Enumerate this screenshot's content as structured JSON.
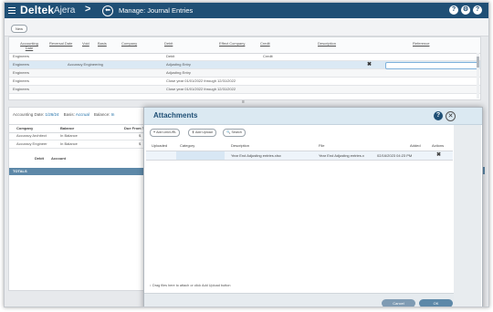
{
  "header": {
    "brand": "Deltek",
    "product": "Ajera",
    "product_chevron": ">",
    "back_glyph": "⬅",
    "title": "Manage: Journal Entries",
    "icons": [
      "help-icon",
      "settings-icon",
      "account-icon"
    ]
  },
  "toolbar": {
    "new_label": "New"
  },
  "journal_grid": {
    "columns": [
      "Accounting Date",
      "Reversal Date",
      "Void",
      "Basis",
      "Company",
      "Debit",
      "Credit",
      "Effect Company",
      "Description",
      "Reference"
    ],
    "rows": [
      {
        "company_col": "Engineers",
        "company": "",
        "debit": "Debit",
        "credit": "Credit",
        "description": ""
      },
      {
        "company_col": "Engineers",
        "company": "Accuracy Engineering",
        "debit": "Adjusting Entry",
        "credit": "",
        "description": ""
      },
      {
        "company_col": "Engineers",
        "company": "",
        "debit": "Adjusting Entry",
        "credit": "",
        "description": ""
      },
      {
        "company_col": "Engineers",
        "company": "",
        "debit": "Close year 01/01/2022 through 12/31/2022",
        "credit": "",
        "description": ""
      },
      {
        "company_col": "Engineers",
        "company": "",
        "debit": "Close year 01/01/2022 through 12/31/2022",
        "credit": "",
        "description": ""
      }
    ],
    "delete_glyph": "✖"
  },
  "details": {
    "accounting_date_label": "Accounting Date:",
    "accounting_date": "1/26/24",
    "basis_label": "Basis:",
    "basis": "Accrual",
    "balance_label": "Balance:",
    "balance_value": "In",
    "columns": [
      "Company",
      "Balance",
      "Due From To"
    ],
    "rows": [
      {
        "company": "Accuracy Architect",
        "balance": "In Balance",
        "due": "$"
      },
      {
        "company": "Accuracy Engineer",
        "balance": "In Balance",
        "due": "$"
      }
    ],
    "entry_columns": [
      "Debit",
      "Account"
    ],
    "totals_label": "TOTALS"
  },
  "attachments_dialog": {
    "title": "Attachments",
    "help_glyph": "?",
    "close_glyph": "✕",
    "buttons": [
      {
        "icon": "+",
        "label": "Add Link/URL"
      },
      {
        "icon": "⇪",
        "label": "Add Upload"
      },
      {
        "icon": "🔍",
        "label": "Search"
      }
    ],
    "columns": [
      "Uploaded",
      "Category",
      "Description",
      "File",
      "Added",
      "Actions"
    ],
    "rows": [
      {
        "uploaded": "",
        "category": "",
        "description": "Year End Adjusting entries.xlsx",
        "file": "Year End Adjusting entries.x",
        "added": "02/16/2023 04:23 PM",
        "action_glyph": "✖"
      }
    ],
    "drop_hint": "Drag files here to attach or click Add Upload button",
    "cancel_label": "Cancel",
    "ok_label": "OK"
  }
}
